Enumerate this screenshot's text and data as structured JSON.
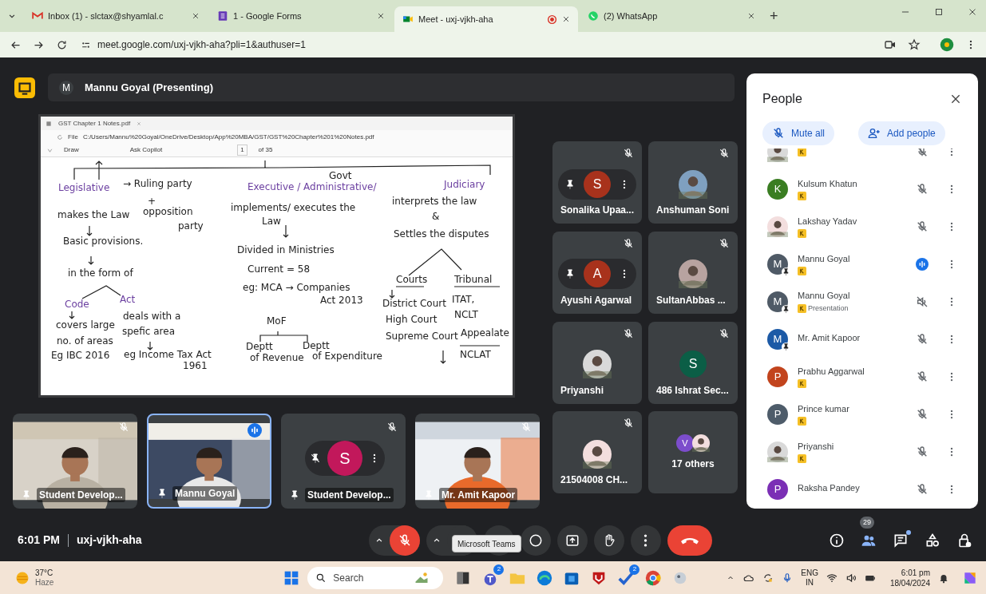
{
  "browser": {
    "tabs": [
      {
        "title": "Inbox (1) - slctax@shyamlal.c",
        "kind": "gmail",
        "selected": false,
        "recording": false
      },
      {
        "title": "1 - Google Forms",
        "kind": "forms",
        "selected": false,
        "recording": false
      },
      {
        "title": "Meet - uxj-vjkh-aha",
        "kind": "meet",
        "selected": true,
        "recording": true
      },
      {
        "title": "(2) WhatsApp",
        "kind": "whatsapp",
        "selected": false,
        "recording": false
      }
    ],
    "new_tab": "+",
    "url": "meet.google.com/uxj-vjkh-aha?pli=1&authuser=1"
  },
  "presenter": {
    "avatar_letter": "M",
    "label": "Mannu Goyal (Presenting)"
  },
  "shared_window": {
    "tab_title": "GST Chapter 1 Notes.pdf",
    "file_label": "File",
    "path": "C:/Users/Mannu%20Goyal/OneDrive/Desktop/App%20MBA/GST/GST%20Chapter%201%20Notes.pdf",
    "draw": "Draw",
    "ask_copilot": "Ask Copilot",
    "page": "1",
    "page_count": "of 35",
    "notes": [
      "Govt",
      "Legislative",
      "→ Ruling party",
      "+",
      "makes the Law",
      "opposition",
      "party",
      "Basic provisions.",
      "in the form of",
      "Code",
      "Act",
      "covers large",
      "no. of areas",
      "Eg IBC 2016",
      "deals with a",
      "spefic area",
      "eg Income Tax Act",
      "1961",
      "Executive / Administrative/",
      "implements/ executes the",
      "Law",
      "Divided in Ministries",
      "Current = 58",
      "eg: MCA → Companies",
      "Act 2013",
      "MoF",
      "Deptt",
      "of Revenue",
      "Deptt",
      "of Expenditure",
      "Judiciary",
      "interprets the law",
      "&",
      "Settles the disputes",
      "Courts",
      "Tribunal",
      "District Court",
      "High Court",
      "Supreme Court",
      "ITAT,",
      "NCLT",
      "Appealate",
      "NCLAT"
    ]
  },
  "tiles": [
    {
      "kind": "person",
      "name": "Sonalika Upaa...",
      "avatar": {
        "kind": "letter",
        "letter": "S",
        "color": "#a8321c"
      },
      "muted": true,
      "controls_shown": true
    },
    {
      "kind": "person",
      "name": "Anshuman Soni",
      "muted": true,
      "controls_shown": false
    },
    {
      "kind": "person",
      "name": "Ayushi Agarwal",
      "avatar": {
        "kind": "letter",
        "letter": "A",
        "color": "#a8321c"
      },
      "muted": true,
      "controls_shown": true
    },
    {
      "kind": "person",
      "name": "SultanAbbas ...",
      "muted": true,
      "controls_shown": false
    },
    {
      "kind": "person",
      "name": "Priyanshi",
      "muted": true,
      "controls_shown": false
    },
    {
      "kind": "person",
      "name": "486 Ishrat Sec...",
      "avatar": {
        "kind": "letter",
        "letter": "S",
        "color": "#0b5e46"
      },
      "muted": true,
      "controls_shown": false
    },
    {
      "kind": "person",
      "name": "21504008 CH...",
      "muted": true,
      "controls_shown": false
    },
    {
      "kind": "others",
      "name": "17 others",
      "letter": "V",
      "color": "#7c4dcc"
    }
  ],
  "filmstrip": [
    {
      "kind": "video",
      "name": "Student Develop...",
      "muted": true,
      "speaking": false,
      "controls_shown": false
    },
    {
      "kind": "video",
      "name": "Mannu Goyal",
      "muted": false,
      "speaking": true,
      "controls_shown": false
    },
    {
      "kind": "avatar",
      "name": "Student Develop...",
      "letter": "S",
      "color": "#c2185b",
      "muted": true,
      "speaking": false,
      "controls_shown": true
    },
    {
      "kind": "video",
      "name": "Mr. Amit Kapoor",
      "muted": true,
      "speaking": false,
      "controls_shown": false
    }
  ],
  "people_panel": {
    "title": "People",
    "mute_all": "Mute all",
    "add_people": "Add people",
    "people": [
      {
        "badge": true,
        "pinned": false,
        "muted": true,
        "speaking": false,
        "sound_off": false
      },
      {
        "name": "Kulsum Khatun",
        "avatar": {
          "kind": "letter",
          "letter": "K",
          "color": "#3a7d22"
        },
        "badge": true,
        "pinned": false,
        "muted": true,
        "speaking": false,
        "sound_off": false
      },
      {
        "name": "Lakshay Yadav",
        "badge": true,
        "pinned": false,
        "muted": true,
        "speaking": false,
        "sound_off": false
      },
      {
        "name": "Mannu Goyal",
        "avatar": {
          "kind": "letter",
          "letter": "M",
          "color": "#4f5a66"
        },
        "badge": true,
        "pinned": true,
        "muted": false,
        "speaking": true,
        "sound_off": false
      },
      {
        "name": "Mannu Goyal",
        "subtitle": "Presentation",
        "avatar": {
          "kind": "letter",
          "letter": "M",
          "color": "#4f5a66"
        },
        "badge": true,
        "pinned": true,
        "muted": false,
        "speaking": false,
        "sound_off": true
      },
      {
        "name": "Mr. Amit Kapoor",
        "avatar": {
          "kind": "letter",
          "letter": "M",
          "color": "#1c5aa6"
        },
        "badge": false,
        "pinned": true,
        "muted": true,
        "speaking": false,
        "sound_off": false
      },
      {
        "name": "Prabhu Aggarwal",
        "avatar": {
          "kind": "letter",
          "letter": "P",
          "color": "#c2441d"
        },
        "badge": true,
        "pinned": false,
        "muted": true,
        "speaking": false,
        "sound_off": false
      },
      {
        "name": "Prince kumar",
        "avatar": {
          "kind": "letter",
          "letter": "P",
          "color": "#4e5c6a"
        },
        "badge": true,
        "pinned": false,
        "muted": true,
        "speaking": false,
        "sound_off": false
      },
      {
        "name": "Priyanshi",
        "badge": true,
        "pinned": false,
        "muted": true,
        "speaking": false,
        "sound_off": false
      },
      {
        "name": "Raksha Pandey",
        "avatar": {
          "kind": "letter",
          "letter": "P",
          "color": "#7b2fb5"
        },
        "badge": false,
        "pinned": false,
        "muted": true,
        "speaking": false,
        "sound_off": false
      }
    ]
  },
  "meeting": {
    "time": "6:01 PM",
    "code": "uxj-vjkh-aha"
  },
  "controls": [
    {
      "kind": "mic",
      "on": false
    },
    {
      "kind": "camera",
      "on": true
    },
    {
      "kind": "captions"
    },
    {
      "kind": "emoji"
    },
    {
      "kind": "present"
    },
    {
      "kind": "hand"
    },
    {
      "kind": "more"
    },
    {
      "kind": "end"
    }
  ],
  "tooltip": "Microsoft Teams",
  "side_buttons": [
    {
      "kind": "info",
      "selected": false
    },
    {
      "kind": "people",
      "selected": true,
      "count": "29"
    },
    {
      "kind": "chat",
      "selected": false,
      "dot": true
    },
    {
      "kind": "activities",
      "selected": false
    },
    {
      "kind": "host",
      "selected": false
    }
  ],
  "taskbar": {
    "temperature": "37°C",
    "weather": "Haze",
    "search": "Search",
    "apps": [
      {
        "kind": "files"
      },
      {
        "kind": "teams",
        "badge": "2"
      },
      {
        "kind": "folder"
      },
      {
        "kind": "edge"
      },
      {
        "kind": "store"
      },
      {
        "kind": "shield"
      },
      {
        "kind": "todo",
        "badge": "2"
      },
      {
        "kind": "chrome"
      },
      {
        "kind": "helper"
      }
    ],
    "language": "ENG",
    "region": "IN",
    "time": "6:01 pm",
    "date": "18/04/2024"
  }
}
